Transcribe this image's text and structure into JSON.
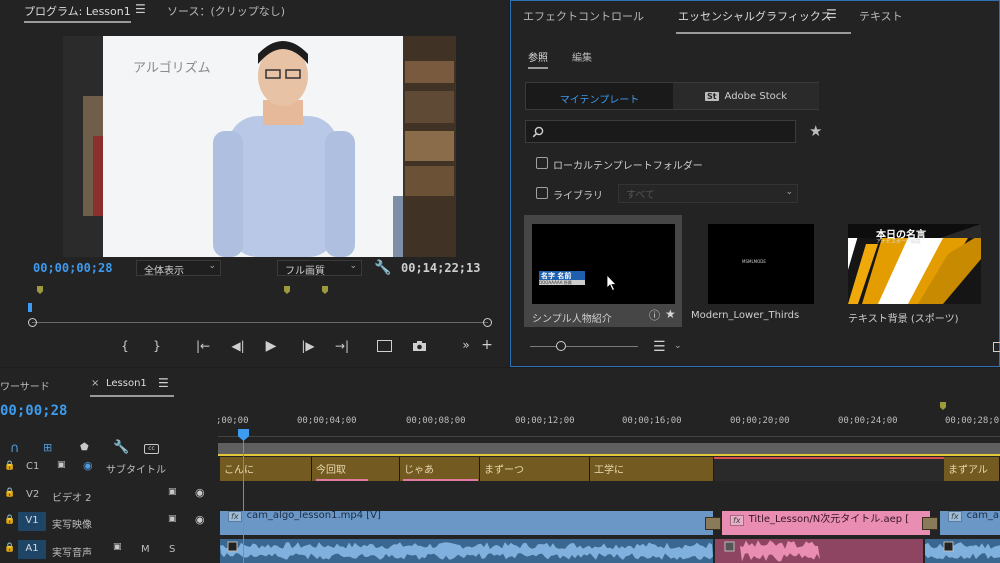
{
  "program_monitor": {
    "tab_program": "プログラム: Lesson1",
    "tab_source": "ソース：(クリップなし)",
    "video_whiteboard_text": "アルゴリズム",
    "timecode_current": "00;00;00;28",
    "timecode_duration": "00;14;22;13",
    "zoom_select": "全体表示",
    "quality_select": "フル画質",
    "transport": {
      "mark_in": "{",
      "mark_out": "}",
      "go_in": "|←",
      "step_back": "◀|",
      "play": "▶",
      "step_forward": "|▶",
      "go_out": "→|",
      "more": "»",
      "add": "+"
    }
  },
  "essential_graphics": {
    "tab_effect_controls": "エフェクトコントロール",
    "tab_essential_graphics": "エッセンシャルグラフィックス",
    "tab_text": "テキスト",
    "subtab_browse": "参照",
    "subtab_edit": "編集",
    "segment_my_templates": "マイテンプレート",
    "segment_adobe_stock": "Adobe Stock",
    "adobe_stock_badge": "St",
    "search_placeholder": "",
    "local_templates_label": "ローカルテンプレートフォルダー",
    "library_label": "ライブラリ",
    "library_select": "すべて",
    "templates": [
      {
        "name": "シンプル人物紹介",
        "preview_title": "名字 名前",
        "preview_sub": "OOOAAAAA 所属"
      },
      {
        "name": "Modern_Lower_Thirds",
        "preview_title": "MSMLMODE"
      },
      {
        "name": "テキスト背景 (スポーツ)",
        "preview_title": "本日の名言",
        "preview_sub": "アナビスポーツ編集"
      }
    ]
  },
  "timeline": {
    "tab_workspace": "ワーサード",
    "tab_sequence": "Lesson1",
    "close_glyph": "×",
    "timecode": "00;00;28",
    "ruler_ticks": [
      ";00;00",
      "00;00;04;00",
      "00;00;08;00",
      "00;00;12;00",
      "00;00;16;00",
      "00;00;20;00",
      "00;00;24;00",
      "00;00;28;0"
    ],
    "tracks": {
      "c1": {
        "id": "C1",
        "name": "サブタイトル"
      },
      "v2": {
        "id": "V2",
        "name": "ビデオ 2"
      },
      "v1": {
        "id": "V1",
        "name": "実写映像"
      },
      "a1": {
        "id": "A1",
        "name": "実写音声",
        "mute": "M",
        "solo": "S"
      }
    },
    "caption_clips": [
      "こんに",
      "今回取",
      "じゃあ",
      "まずーつ",
      "工学に",
      "",
      "",
      "まずアル"
    ],
    "v1_clips": {
      "clip1": "cam_algo_lesson1.mp4 [V]",
      "clip2": "Title_Lesson/N次元タイトル.aep [",
      "clip3": "cam_a",
      "fx": "fx"
    }
  }
}
